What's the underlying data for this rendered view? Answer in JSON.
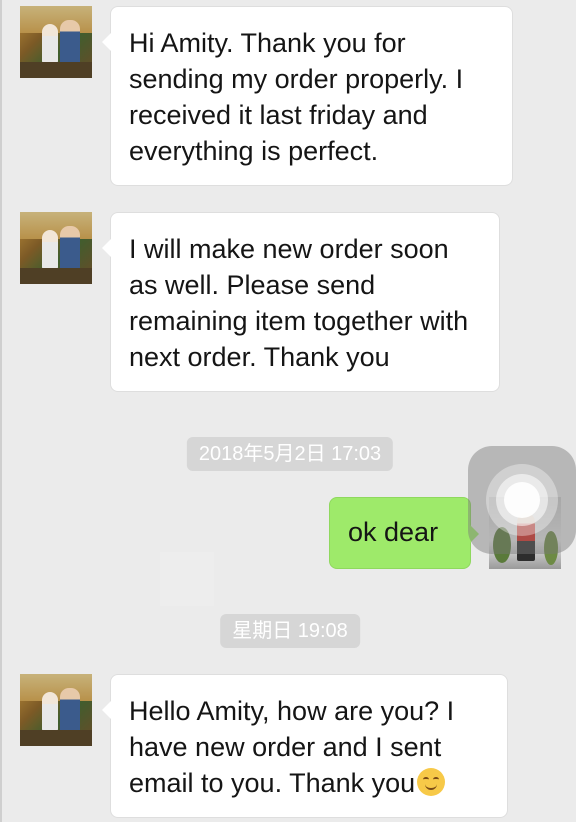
{
  "messages": [
    {
      "direction": "incoming",
      "text": "Hi Amity. Thank you for sending my order properly. I received it last friday and everything is perfect."
    },
    {
      "direction": "incoming",
      "text": "I will make new order soon as well. Please send remaining item together with next order. Thank you"
    },
    {
      "direction": "outgoing",
      "text": "ok dear"
    },
    {
      "direction": "incoming",
      "text": "Hello Amity, how are you? I have new order and I sent email to you. Thank you"
    }
  ],
  "timestamps": [
    "2018年5月2日 17:03",
    "星期日 19:08"
  ],
  "emoji": "smiling-face",
  "colors": {
    "background": "#ebebeb",
    "incoming_bubble": "#ffffff",
    "outgoing_bubble": "#9eea6a",
    "timestamp_bg": "#d6d6d6"
  }
}
